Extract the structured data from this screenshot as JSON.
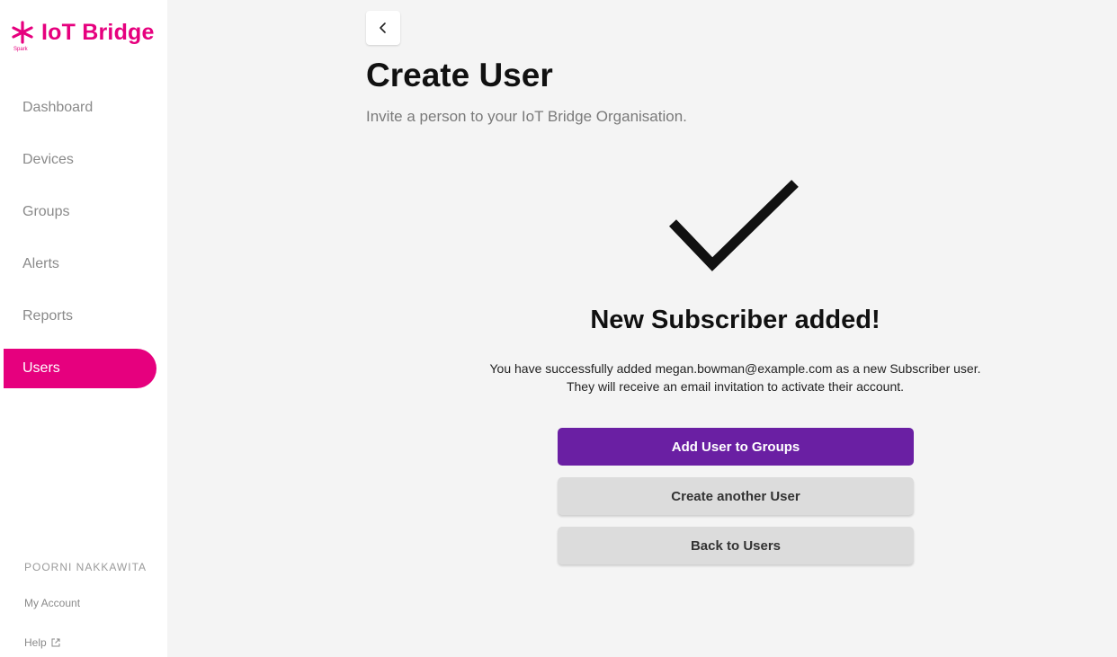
{
  "brand": {
    "name": "IoT Bridge",
    "sub": "Spark",
    "color": "#e6007e"
  },
  "sidebar": {
    "items": [
      {
        "label": "Dashboard",
        "active": false
      },
      {
        "label": "Devices",
        "active": false
      },
      {
        "label": "Groups",
        "active": false
      },
      {
        "label": "Alerts",
        "active": false
      },
      {
        "label": "Reports",
        "active": false
      },
      {
        "label": "Users",
        "active": true
      }
    ],
    "user_name": "POORNI NAKKAWITA",
    "my_account": "My Account",
    "help": "Help"
  },
  "main": {
    "back_icon": "chevron-left-icon",
    "title": "Create User",
    "subtitle": "Invite a person to your IoT Bridge Organisation.",
    "success_icon": "checkmark-icon",
    "success_title": "New Subscriber added!",
    "success_line1": "You have successfully added megan.bowman@example.com as a new Subscriber user.",
    "success_line2": "They will receive an email invitation to activate their account.",
    "buttons": {
      "add_to_groups": "Add User to Groups",
      "create_another": "Create another User",
      "back_to_users": "Back to Users"
    }
  },
  "colors": {
    "accent": "#e6007e",
    "primary_button": "#6a1fa3",
    "secondary_button": "#dcdcdc",
    "background": "#f4f4f4"
  }
}
